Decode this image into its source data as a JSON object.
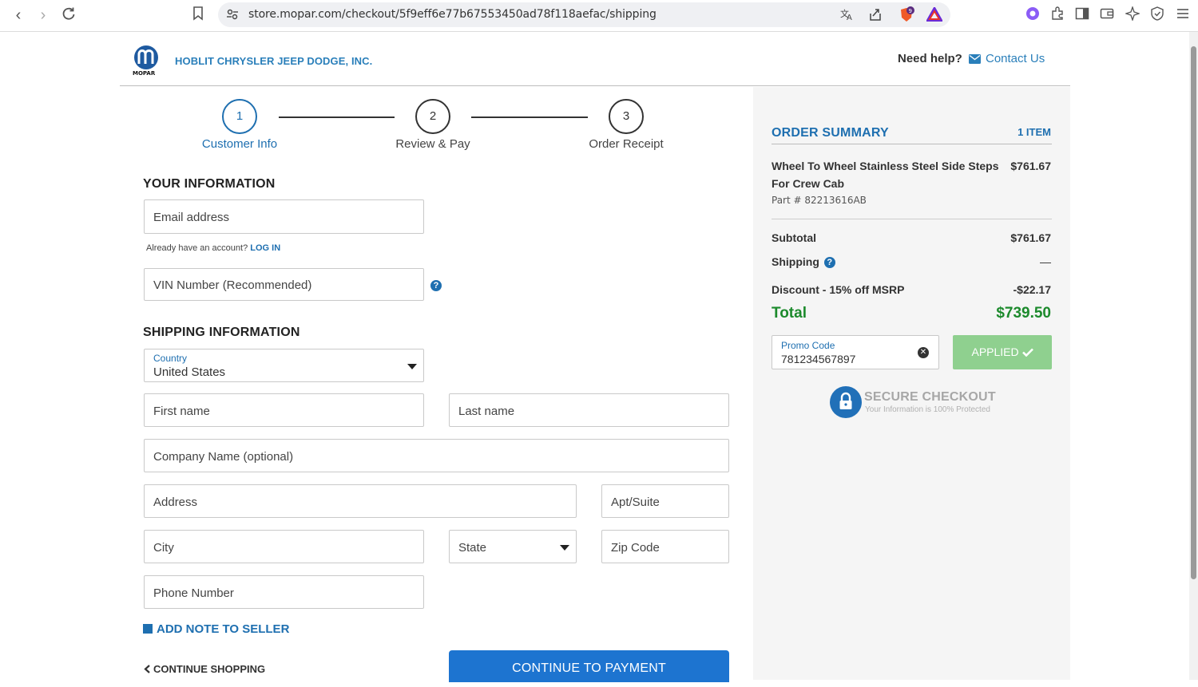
{
  "browser": {
    "url": "store.mopar.com/checkout/5f9eff6e77b67553450ad78f118aefac/shipping",
    "brave_badge": "9"
  },
  "header": {
    "dealer_name": "HOBLIT CHRYSLER JEEP DODGE, INC.",
    "need_help": "Need help?",
    "contact_us": "Contact Us",
    "logo_text": "MOPAR"
  },
  "steps": [
    {
      "number": "1",
      "label": "Customer Info",
      "active": true
    },
    {
      "number": "2",
      "label": "Review & Pay",
      "active": false
    },
    {
      "number": "3",
      "label": "Order Receipt",
      "active": false
    }
  ],
  "your_info": {
    "title": "YOUR INFORMATION",
    "email_placeholder": "Email address",
    "account_prompt": "Already have an account?",
    "login_link": "LOG IN",
    "vin_placeholder": "VIN Number (Recommended)",
    "help_glyph": "?"
  },
  "shipping": {
    "title": "SHIPPING INFORMATION",
    "country_label": "Country",
    "country_value": "United States",
    "first_name": "First name",
    "last_name": "Last name",
    "company": "Company Name (optional)",
    "address": "Address",
    "apt": "Apt/Suite",
    "city": "City",
    "state": "State",
    "zip": "Zip Code",
    "phone": "Phone Number"
  },
  "actions": {
    "add_note": "ADD NOTE TO SELLER",
    "continue_shopping": "CONTINUE SHOPPING",
    "continue_payment": "CONTINUE TO PAYMENT"
  },
  "order_summary": {
    "title": "ORDER SUMMARY",
    "item_count": "1 ITEM",
    "item_name": "Wheel To Wheel Stainless Steel Side Steps For Crew Cab",
    "item_price": "$761.67",
    "item_part": "Part # 82213616AB",
    "subtotal_label": "Subtotal",
    "subtotal_value": "$761.67",
    "shipping_label": "Shipping",
    "shipping_value": "—",
    "discount_label": "Discount - 15% off MSRP",
    "discount_value": "-$22.17",
    "total_label": "Total",
    "total_value": "$739.50",
    "promo_label": "Promo Code",
    "promo_value": "781234567897",
    "applied_label": "APPLIED",
    "secure_title": "SECURE CHECKOUT",
    "secure_sub": "Your Information is 100% Protected"
  },
  "colors": {
    "brand_blue": "#1e6fb0",
    "button_blue": "#1d74d0",
    "total_green": "#1c8a2c",
    "applied_green": "#8fd08f"
  }
}
